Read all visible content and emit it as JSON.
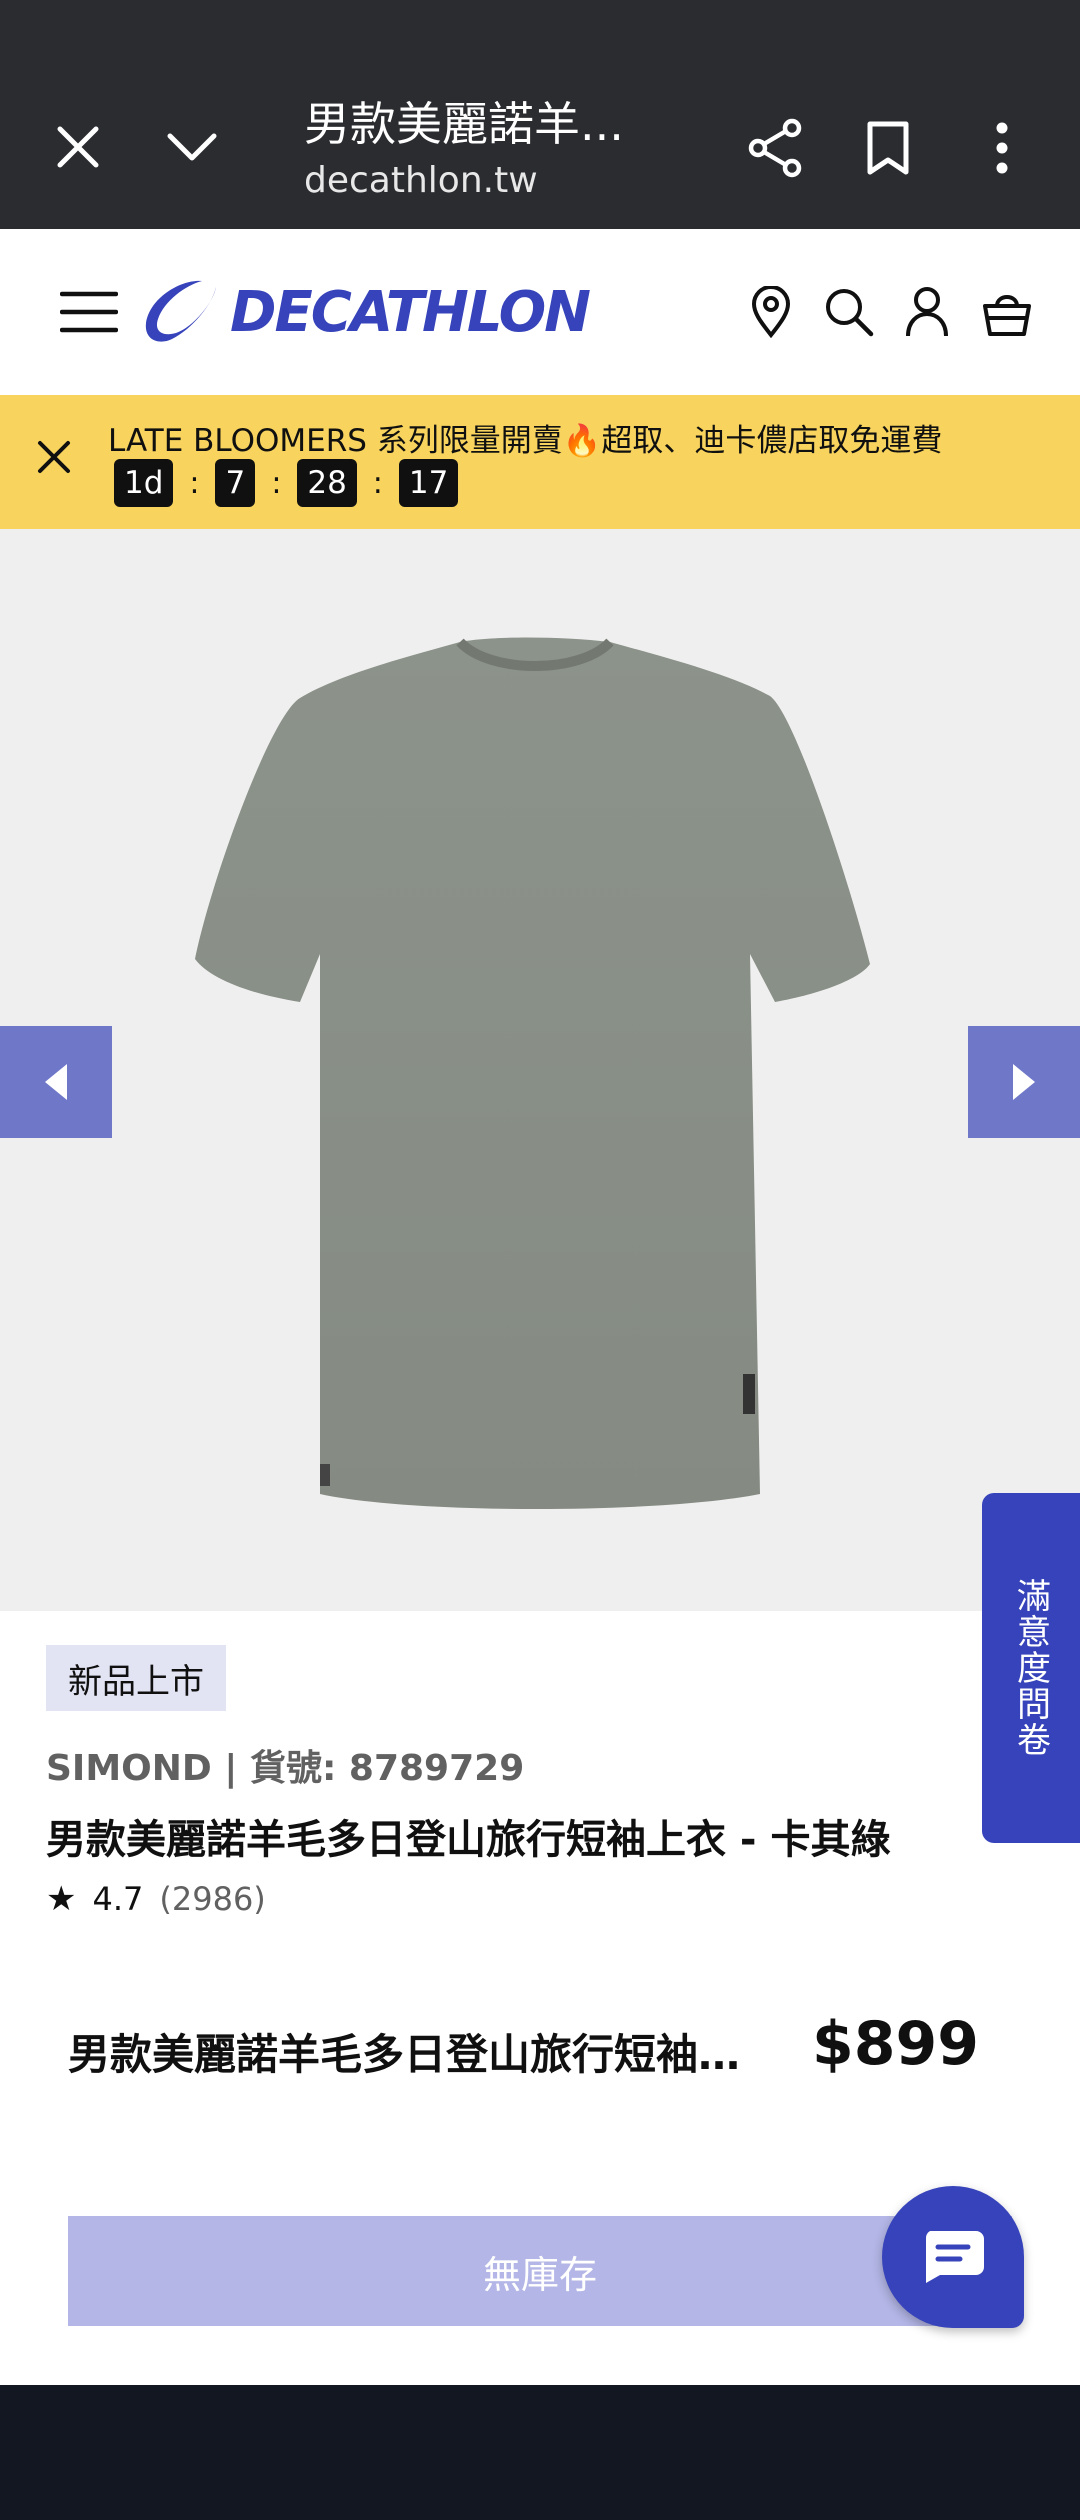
{
  "browser": {
    "title": "男款美麗諾羊...",
    "url": "decathlon.tw"
  },
  "header": {
    "logo_text": "DECATHLON",
    "brand_color": "#3643ba"
  },
  "promo": {
    "text": "LATE BLOOMERS 系列限量開賣🔥超取、迪卡儂店取免運費",
    "countdown": {
      "days": "1d",
      "hours": "7",
      "minutes": "28",
      "seconds": "17",
      "separator": ":"
    },
    "background": "#f8d45e"
  },
  "survey": {
    "label": "滿意度問卷"
  },
  "product": {
    "badge": "新品上市",
    "brand_line": "SIMOND | 貨號: 8789729",
    "title": "男款美麗諾羊毛多日登山旅行短袖上衣 - 卡其綠",
    "rating": {
      "star": "★",
      "score": "4.7",
      "count": "(2986)"
    }
  },
  "sticky": {
    "name": "男款美麗諾羊毛多日登山旅行短袖上衣 - 卡其綠",
    "price": "$899",
    "oos_label": "無庫存"
  },
  "icons": {
    "close": "close-icon",
    "chevron": "chevron-down-icon",
    "share": "share-icon",
    "bookmark": "bookmark-icon",
    "more": "more-vertical-icon",
    "menu": "menu-icon",
    "location": "location-pin-icon",
    "search": "search-icon",
    "account": "account-icon",
    "cart": "cart-icon",
    "chat": "chat-icon"
  }
}
